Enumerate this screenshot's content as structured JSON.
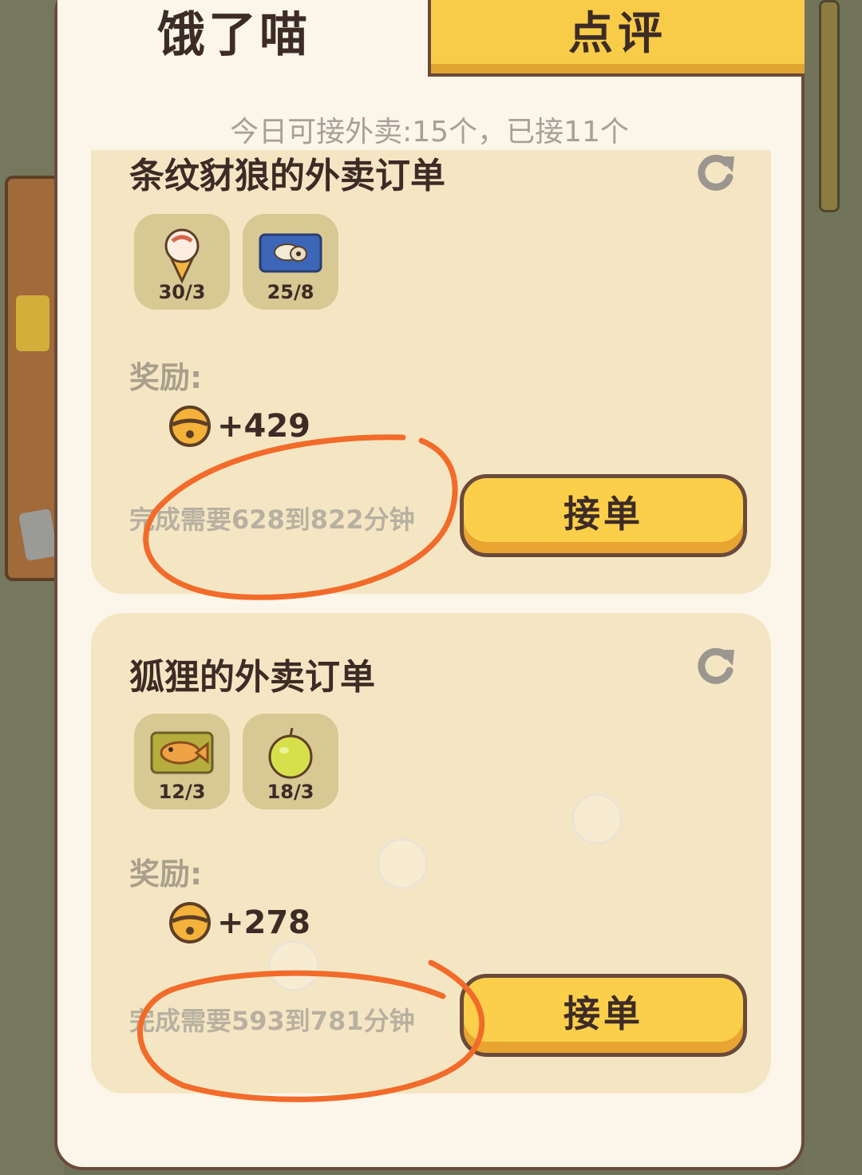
{
  "tabs": [
    {
      "label": "饿了喵",
      "active": true
    },
    {
      "label": "点评",
      "active": false
    }
  ],
  "quota_text": "今日可接外卖:15个，已接11个",
  "orders": [
    {
      "title": "条纹豺狼的外卖订单",
      "items": [
        {
          "icon": "ice-cream-icon",
          "count": "30/3"
        },
        {
          "icon": "sushi-roll-icon",
          "count": "25/8"
        }
      ],
      "reward_label": "奖励:",
      "reward_amount": "+429",
      "duration": "完成需要628到822分钟",
      "accept_label": "接单"
    },
    {
      "title": "狐狸的外卖订单",
      "items": [
        {
          "icon": "taiyaki-icon",
          "count": "12/3"
        },
        {
          "icon": "lime-fruit-icon",
          "count": "18/3"
        }
      ],
      "reward_label": "奖励:",
      "reward_amount": "+278",
      "duration": "完成需要593到781分钟",
      "accept_label": "接单"
    }
  ],
  "colors": {
    "panel_bg": "#fcf5ea",
    "card_bg": "#f5e6c3",
    "button_yellow": "#fbcf4a",
    "tab_yellow": "#f8cc48",
    "text_dark": "#3d2b26",
    "annotation_orange": "#f26b2a"
  }
}
